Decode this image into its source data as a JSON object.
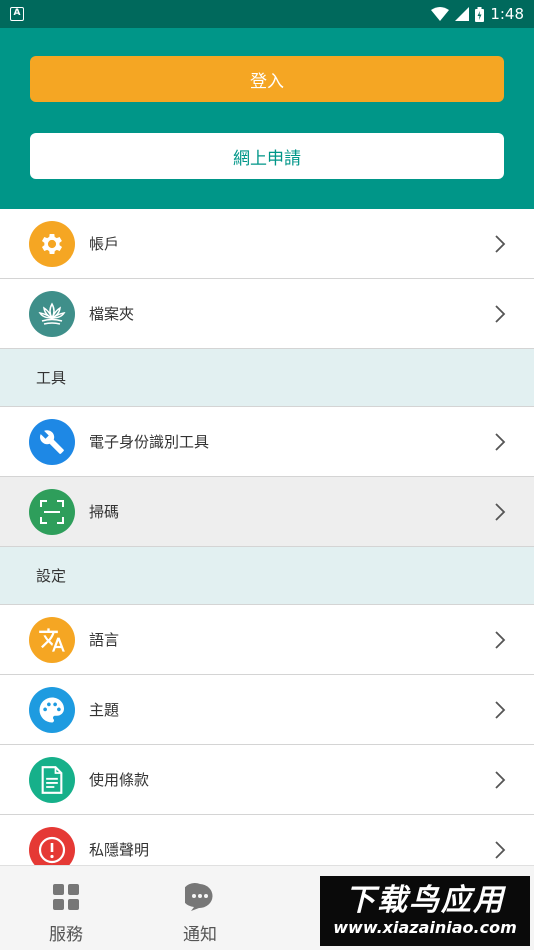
{
  "status_bar": {
    "notification_glyph": "A",
    "time": "1:48",
    "icons": [
      "wifi-icon",
      "signal-icon",
      "battery-icon"
    ]
  },
  "header": {
    "login_label": "登入",
    "apply_label": "網上申請",
    "bg_color": "#009688",
    "login_color": "#f5a623"
  },
  "menu": {
    "account": {
      "label": "帳戶",
      "icon": "gear-icon",
      "color": "#f5a623"
    },
    "folder": {
      "label": "檔案夾",
      "icon": "lotus-icon",
      "color": "#3f8f8a"
    },
    "tools_header": "工具",
    "eid_tool": {
      "label": "電子身份識別工具",
      "icon": "wrench-icon",
      "color": "#1e88e5"
    },
    "scan": {
      "label": "掃碼",
      "icon": "scan-icon",
      "color": "#2e9e5b"
    },
    "settings_header": "設定",
    "language": {
      "label": "語言",
      "icon": "translate-icon",
      "color": "#f5a623"
    },
    "theme": {
      "label": "主題",
      "icon": "palette-icon",
      "color": "#1e9be0"
    },
    "terms": {
      "label": "使用條款",
      "icon": "document-icon",
      "color": "#16b08a"
    },
    "privacy": {
      "label": "私隱聲明",
      "icon": "exclamation-icon",
      "color": "#e53935"
    }
  },
  "bottom_nav": {
    "services": {
      "label": "服務",
      "icon": "grid-icon"
    },
    "notifications": {
      "label": "通知",
      "icon": "chat-icon"
    }
  },
  "watermark": {
    "title": "下载鸟应用",
    "url": "www.xiazainiao.com"
  }
}
